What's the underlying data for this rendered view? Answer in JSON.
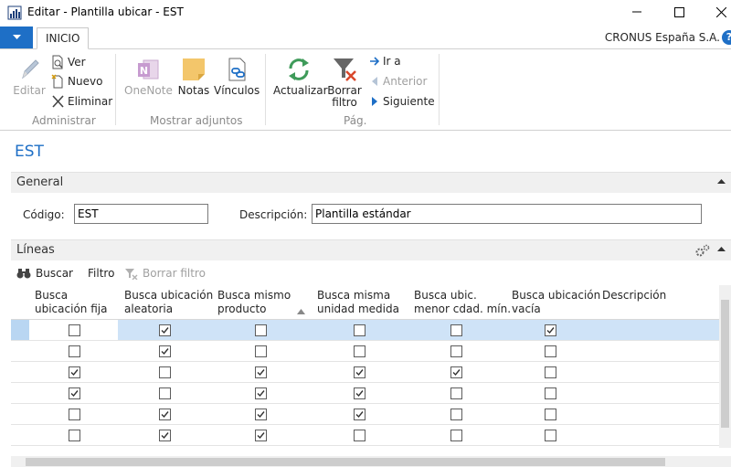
{
  "window": {
    "title": "Editar - Plantilla ubicar - EST"
  },
  "ribbon": {
    "tab": "INICIO",
    "company": "CRONUS España S.A.",
    "groups": {
      "administrar": {
        "label": "Administrar",
        "editar": "Editar",
        "ver": "Ver",
        "nuevo": "Nuevo",
        "eliminar": "Eliminar"
      },
      "adjuntos": {
        "label": "Mostrar adjuntos",
        "onenote": "OneNote",
        "notas": "Notas",
        "vinculos": "Vínculos"
      },
      "pag": {
        "label": "Pág.",
        "actualizar": "Actualizar",
        "borrar_filtro_1": "Borrar",
        "borrar_filtro_2": "filtro",
        "ir_a": "Ir a",
        "anterior": "Anterior",
        "siguiente": "Siguiente"
      }
    }
  },
  "page": {
    "title": "EST"
  },
  "general": {
    "header": "General",
    "codigo_label": "Código:",
    "codigo_value": "EST",
    "descripcion_label": "Descripción:",
    "descripcion_value": "Plantilla estándar"
  },
  "lineas": {
    "header": "Líneas",
    "toolbar": {
      "buscar": "Buscar",
      "filtro": "Filtro",
      "borrar_filtro": "Borrar filtro"
    },
    "columns": [
      [
        "Busca",
        "ubicación fija"
      ],
      [
        "Busca ubicación",
        "aleatoria"
      ],
      [
        "Busca mismo",
        "producto"
      ],
      [
        "Busca misma",
        "unidad medida"
      ],
      [
        "Busca ubic.",
        "menor cdad. mín."
      ],
      [
        "Busca ubicación",
        "vacía"
      ],
      [
        "Descripción",
        ""
      ]
    ],
    "rows": [
      [
        false,
        true,
        false,
        false,
        false,
        true
      ],
      [
        false,
        true,
        false,
        false,
        false,
        false
      ],
      [
        true,
        false,
        true,
        true,
        true,
        false
      ],
      [
        true,
        false,
        true,
        true,
        false,
        false
      ],
      [
        false,
        true,
        true,
        true,
        false,
        false
      ],
      [
        false,
        true,
        true,
        false,
        false,
        false
      ]
    ]
  },
  "colors": {
    "accent": "#1e6fc6",
    "selected_row": "#cfe3f7"
  }
}
